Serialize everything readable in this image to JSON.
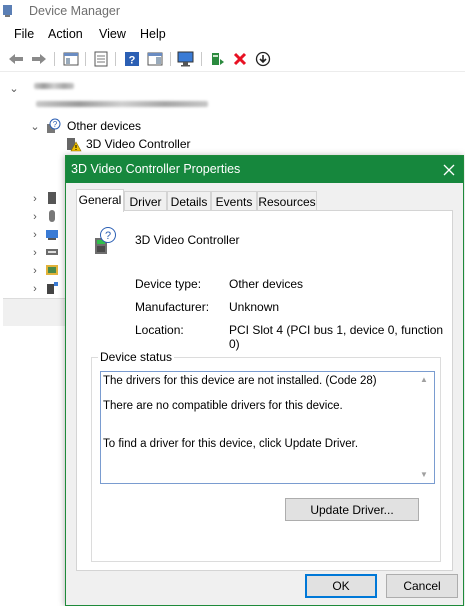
{
  "device_manager": {
    "title": "Device Manager",
    "menu": [
      "File",
      "Action",
      "View",
      "Help"
    ],
    "toolbar": [
      {
        "icon": "back-arrow-icon"
      },
      {
        "icon": "forward-arrow-icon"
      },
      {
        "icon": "show-hide-console-tree-icon"
      },
      {
        "icon": "properties-sheet-icon"
      },
      {
        "icon": "help-icon"
      },
      {
        "icon": "action-pane-icon"
      },
      {
        "icon": "scan-hardware-icon"
      },
      {
        "icon": "update-driver-icon"
      },
      {
        "icon": "uninstall-device-icon"
      },
      {
        "icon": "enable-device-icon"
      }
    ],
    "tree": {
      "other_devices_label": "Other devices",
      "video_controller_label": "3D Video Controller"
    }
  },
  "dialog": {
    "title": "3D Video Controller Properties",
    "tabs": [
      "General",
      "Driver",
      "Details",
      "Events",
      "Resources"
    ],
    "active_tab": "General",
    "device_name": "3D Video Controller",
    "properties": [
      {
        "label": "Device type:",
        "value": "Other devices"
      },
      {
        "label": "Manufacturer:",
        "value": "Unknown"
      },
      {
        "label": "Location:",
        "value": "PCI Slot 4 (PCI bus 1, device 0, function 0)"
      }
    ],
    "device_status_label": "Device status",
    "status_lines": [
      "The drivers for this device are not installed. (Code 28)",
      "There are no compatible drivers for this device.",
      "To find a driver for this device, click Update Driver."
    ],
    "update_driver_label": "Update Driver...",
    "ok_label": "OK",
    "cancel_label": "Cancel"
  },
  "colors": {
    "dialog_title_bar": "#16873d",
    "focus_border": "#0078d7",
    "error_red": "#e81123"
  }
}
